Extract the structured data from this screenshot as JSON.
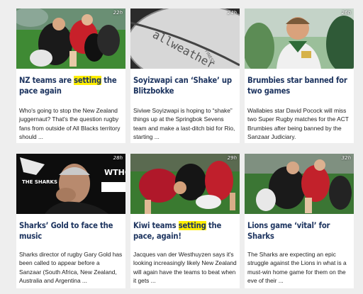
{
  "cards": [
    {
      "age": "22h",
      "title_pre": "NZ teams are ",
      "title_hl": "setting",
      "title_post": " the pace again",
      "desc": "Who's going to stop the New Zealand juggernaut? That's the question rugby fans from outside of All Blacks territory should ..."
    },
    {
      "age": "24h",
      "title_pre": "Soyizwapi can ‘Shake’ up Blitzbokke",
      "title_hl": "",
      "title_post": "",
      "desc": "Siviwe Soyizwapi is hoping to “shake” things up at the Springbok Sevens team and make a last-ditch bid for Rio, starting ...",
      "image_text": "allweather",
      "image_text2": "FINEST"
    },
    {
      "age": "26h",
      "title_pre": "Brumbies star banned for two games",
      "title_hl": "",
      "title_post": "",
      "desc": "Wallabies star David Pocock will miss two Super Rugby matches for the ACT Brumbies after being banned by the Sanzaar Judiciary."
    },
    {
      "age": "28h",
      "title_pre": "Sharks’ Gold to face the music",
      "title_hl": "",
      "title_post": "",
      "desc": "Sharks director of rugby Gary Gold has been called to appear before a Sanzaar (South Africa, New Zealand, Australia and Argentina ...",
      "image_text": "THE SHARKS",
      "image_text2": "WTHO"
    },
    {
      "age": "29h",
      "title_pre": "Kiwi teams ",
      "title_hl": "setting",
      "title_post": " the pace, again!",
      "desc": "Jacques van der Westhuyzen says it's looking increasingly likely New Zealand will again have the teams to beat when it gets ..."
    },
    {
      "age": "32h",
      "title_pre": "Lions game ‘vital’ for Sharks",
      "title_hl": "",
      "title_post": "",
      "desc": "The Sharks are expecting an epic struggle against the Lions in what is a must-win home game for them on the eve of their ..."
    }
  ]
}
